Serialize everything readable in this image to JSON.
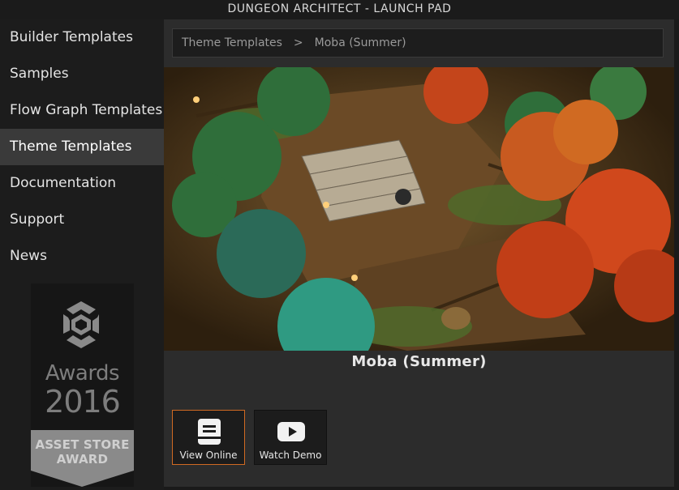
{
  "window": {
    "title": "DUNGEON ARCHITECT - LAUNCH PAD"
  },
  "sidebar": {
    "items": [
      {
        "label": "Builder Templates",
        "active": false
      },
      {
        "label": "Samples",
        "active": false
      },
      {
        "label": "Flow Graph Templates",
        "active": false
      },
      {
        "label": "Theme Templates",
        "active": true
      },
      {
        "label": "Documentation",
        "active": false
      },
      {
        "label": "Support",
        "active": false
      },
      {
        "label": "News",
        "active": false
      }
    ],
    "award": {
      "line1": "Awards",
      "line2": "2016",
      "banner1": "ASSET STORE",
      "banner2": "AWARD"
    }
  },
  "main": {
    "breadcrumb": {
      "root": "Theme Templates",
      "separator": ">",
      "current": "Moba (Summer)"
    },
    "hero_caption": "Moba (Summer)",
    "actions": [
      {
        "label": "View Online",
        "icon": "document-icon",
        "highlighted": true
      },
      {
        "label": "Watch Demo",
        "icon": "youtube-play-icon",
        "highlighted": false
      }
    ]
  },
  "colors": {
    "accent": "#d06a22",
    "sidebar_bg": "#1c1c1c",
    "active_bg": "#3a3a3a",
    "panel_bg": "#2c2c2c"
  }
}
